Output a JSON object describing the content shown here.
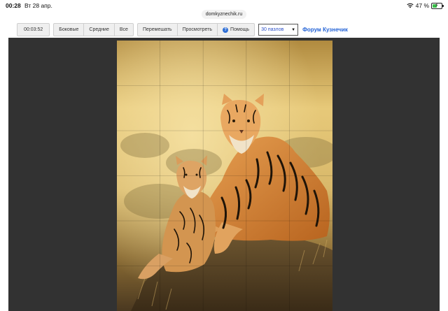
{
  "status": {
    "time": "00:28",
    "date": "Вт 28 апр.",
    "battery_text": "47 %",
    "battery_level": 0.47
  },
  "url": "domkyznechik.ru",
  "toolbar": {
    "timer": "00:03:52",
    "mode_buttons": [
      "Боковые",
      "Средние",
      "Все"
    ],
    "action_buttons": {
      "shuffle": "Перемешать",
      "preview": "Просмотреть",
      "help": "Помощь"
    },
    "piece_select": "30 пазлов",
    "forum_link": "Форум Кузнечик"
  },
  "colors": {
    "board": "#323232",
    "link": "#2463d6",
    "accent": "#3cc14b"
  },
  "puzzle": {
    "image": "tigers",
    "rows": 6,
    "cols": 5
  }
}
